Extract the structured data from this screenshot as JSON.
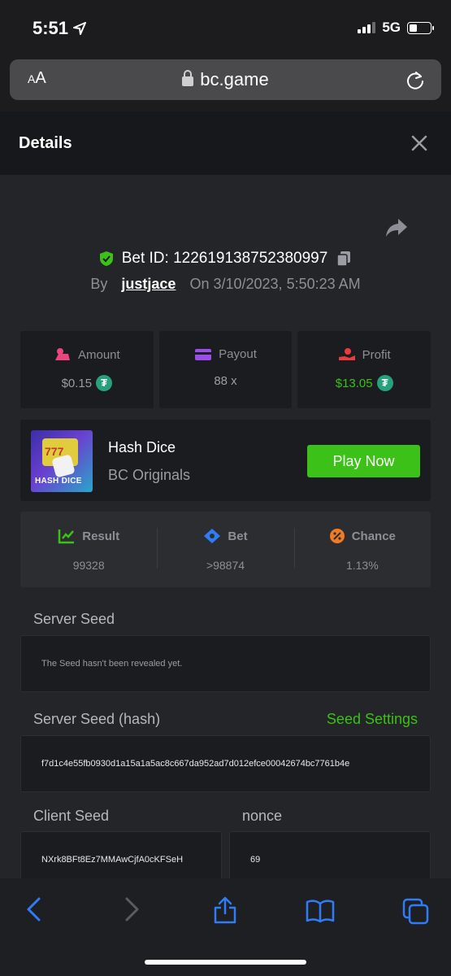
{
  "status_bar": {
    "time": "5:51",
    "network": "5G"
  },
  "browser": {
    "text_size_label_small": "A",
    "text_size_label_large": "A",
    "domain": "bc.game"
  },
  "panel": {
    "title": "Details"
  },
  "bet": {
    "id_label": "Bet ID: 122619138752380997",
    "by_label": "By",
    "user": "justjace",
    "on_label": "On",
    "datetime": "3/10/2023, 5:50:23 AM"
  },
  "stats": {
    "amount": {
      "label": "Amount",
      "value": "$0.15"
    },
    "payout": {
      "label": "Payout",
      "value": "88 x"
    },
    "profit": {
      "label": "Profit",
      "value": "$13.05"
    },
    "currency_glyph": "₮"
  },
  "game": {
    "thumb_label": "HASH DICE",
    "name": "Hash Dice",
    "provider": "BC Originals",
    "play_label": "Play Now"
  },
  "outcome": {
    "result": {
      "label": "Result",
      "value": "99328"
    },
    "bet": {
      "label": "Bet",
      "value": ">98874"
    },
    "chance": {
      "label": "Chance",
      "value": "1.13%"
    }
  },
  "seeds": {
    "server_seed_label": "Server Seed",
    "server_seed_value": "The Seed hasn't been revealed yet.",
    "server_hash_label": "Server Seed (hash)",
    "seed_settings_label": "Seed Settings",
    "server_hash_value": "f7d1c4e55fb0930d1a15a1a5ac8c667da952ad7d012efce00042674bc7761b4e",
    "client_seed_label": "Client Seed",
    "client_seed_value": "NXrk8BFt8Ez7MMAwCjfA0cKFSeH",
    "nonce_label": "nonce",
    "nonce_value": "69"
  },
  "colors": {
    "accent_green": "#3bc117",
    "usdt": "#26a17b",
    "panel_bg": "#232528",
    "card_bg": "#1a1c1f",
    "ios_blue": "#2f7cf6"
  }
}
